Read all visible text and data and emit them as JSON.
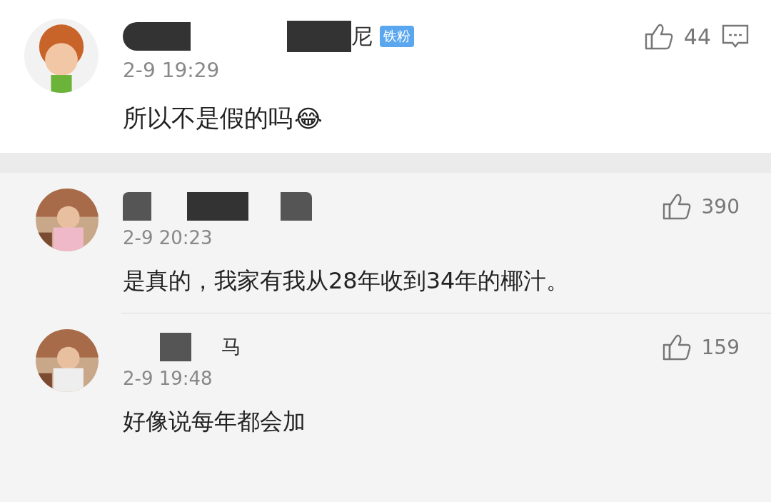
{
  "main_comment": {
    "name_visible": "尼",
    "badge": "铁粉",
    "time": "2-9 19:29",
    "likes": "44",
    "text": "所以不是假的吗",
    "emoji": "😂"
  },
  "replies": [
    {
      "time": "2-9 20:23",
      "likes": "390",
      "text": "是真的，我家有我从28年收到34年的椰汁。"
    },
    {
      "name_visible": "马",
      "time": "2-9 19:48",
      "likes": "159",
      "text": "好像说每年都会加"
    }
  ]
}
